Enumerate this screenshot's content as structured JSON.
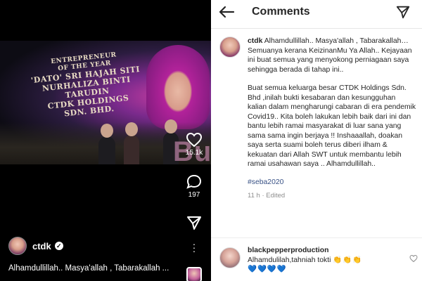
{
  "reel": {
    "headline_line1": "ENTREPRENEUR",
    "headline_line2": "OF THE YEAR",
    "headline_line3": "'DATO' SRI HAJAH SITI",
    "headline_line4": "NURHALIZA BINTI TARUDIN",
    "headline_line5": "CTDK HOLDINGS",
    "headline_line6": "SDN. BHD.",
    "watermark": "Buku",
    "likes": "15.1k",
    "comments_count": "197",
    "author": "ctdk",
    "caption": "Alhamdullillah.. Masya'allah , Tabarakallah ..."
  },
  "comments_panel": {
    "title": "Comments",
    "main": {
      "username": "ctdk",
      "para1": "Alhamdullillah.. Masya'allah , Tabarakallah… Semuanya kerana KeizinanMu Ya Allah.. Kejayaan ini buat semua yang menyokong perniagaan saya sehingga berada di tahap ini..",
      "para2": "Buat semua keluarga besar CTDK Holdings Sdn. Bhd ,inilah bukti kesabaran dan kesungguhan kalian dalam mengharungi cabaran di era pendemik Covid19.. Kita boleh lakukan lebih baik dari ini dan bantu lebih ramai masyarakat di luar sana yang sama sama ingin berjaya !! Inshaaallah, doakan saya serta suami boleh terus diberi ilham & kekuatan dari Allah SWT untuk membantu lebih ramai usahawan saya .. Alhamdullillah..",
      "hashtag": "#seba2020",
      "time": "11 h",
      "edited": "Edited"
    },
    "reply": {
      "username": "blackpepperproduction",
      "text": "Alhamdulilah,tahniah tokti",
      "emoji_clap": "👏👏👏",
      "emoji_hearts": "💙💙💙💙"
    }
  },
  "colors": {
    "hashtag": "#385185",
    "meta": "#8e8e8e",
    "text": "#262626"
  }
}
